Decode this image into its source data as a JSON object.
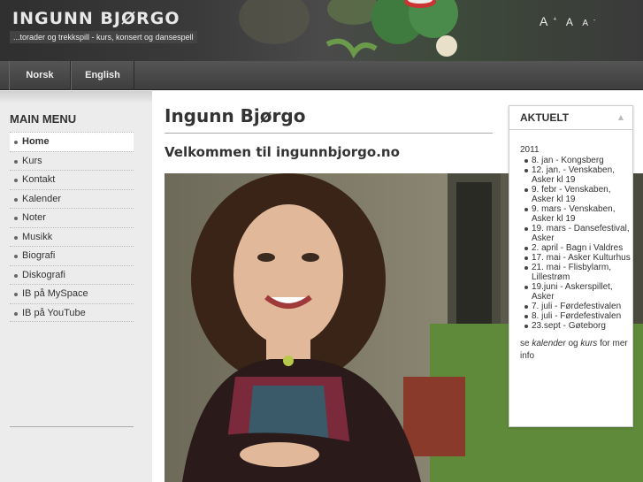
{
  "header": {
    "title": "INGUNN BJØRGO",
    "slogan": "...torader og trekkspill - kurs, konsert og dansespell",
    "font_controls": {
      "increase": "A",
      "reset": "A",
      "decrease": "A"
    }
  },
  "nav": {
    "tabs": [
      {
        "label": "Norsk"
      },
      {
        "label": "English"
      }
    ]
  },
  "sidebar": {
    "title": "MAIN MENU",
    "items": [
      {
        "label": "Home",
        "active": true
      },
      {
        "label": "Kurs"
      },
      {
        "label": "Kontakt"
      },
      {
        "label": "Kalender"
      },
      {
        "label": "Noter"
      },
      {
        "label": "Musikk"
      },
      {
        "label": "Biografi"
      },
      {
        "label": "Diskografi"
      },
      {
        "label": "IB på MySpace"
      },
      {
        "label": "IB på YouTube"
      }
    ]
  },
  "main": {
    "title": "Ingunn Bjørgo",
    "welcome": "Velkommen til ingunnbjorgo.no"
  },
  "aktuelt": {
    "title": "AKTUELT",
    "year": "2011",
    "events": [
      "8. jan - Kongsberg",
      "12. jan. - Venskaben, Asker kl 19",
      "9. febr - Venskaben, Asker kl 19",
      "9. mars - Venskaben, Asker kl 19",
      "19. mars - Dansefestival, Asker",
      "2. april - Bagn i Valdres",
      "17. mai - Asker Kulturhus",
      "21. mai - Flisbylarm, Lillestrøm",
      "19.juni - Askerspillet, Asker",
      "7. juli - Førdefestivalen",
      "8. juli - Førdefestivalen",
      "23.sept - Gøteborg"
    ],
    "note_prefix": "se ",
    "note_link1": "kalender",
    "note_mid": " og ",
    "note_link2": "kurs",
    "note_suffix": " for mer info"
  },
  "colors": {
    "header_bg": "#3a3a3a",
    "nav_bg": "#474747",
    "sidebar_bg": "#ececec"
  }
}
